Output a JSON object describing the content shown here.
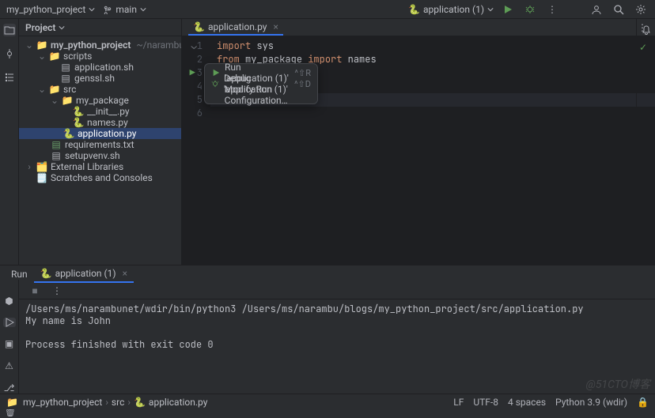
{
  "topbar": {
    "project": "my_python_project",
    "branch": "main",
    "run_config": "application (1)"
  },
  "project_pane": {
    "title": "Project",
    "root": "my_python_project",
    "root_path": "~/narambu/blogs/my_python_",
    "scripts": "scripts",
    "application_sh": "application.sh",
    "genssl_sh": "genssl.sh",
    "src": "src",
    "my_package": "my_package",
    "init_py": "__init__.py",
    "names_py": "names.py",
    "application_py": "application.py",
    "requirements": "requirements.txt",
    "setupvenv": "setupvenv.sh",
    "external_libs": "External Libraries",
    "scratches": "Scratches and Consoles"
  },
  "editor": {
    "tab": "application.py",
    "lines": {
      "l1_import": "import",
      "l1_sys": "sys",
      "l2_from": "from",
      "l2_pkg": "my_package",
      "l2_import": "import",
      "l2_names": "names"
    }
  },
  "context_menu": {
    "run": "Run 'application (1)'",
    "run_sc": "^⇧R",
    "debug": "Debug 'application (1)'",
    "debug_sc": "^⇧D",
    "modify": "Modify Run Configuration…"
  },
  "run_panel": {
    "tab_run": "Run",
    "tab_app": "application (1)",
    "console": {
      "l1": "/Users/ms/narambunet/wdir/bin/python3 /Users/ms/narambu/blogs/my_python_project/src/application.py",
      "l2": "My name is John",
      "l3": "",
      "l4": "Process finished with exit code 0"
    }
  },
  "status": {
    "c1": "my_python_project",
    "c2": "src",
    "c3": "application.py",
    "lf": "LF",
    "enc": "UTF-8",
    "indent": "4 spaces",
    "python": "Python 3.9 (wdir)"
  },
  "watermark": "@51CTO博客"
}
